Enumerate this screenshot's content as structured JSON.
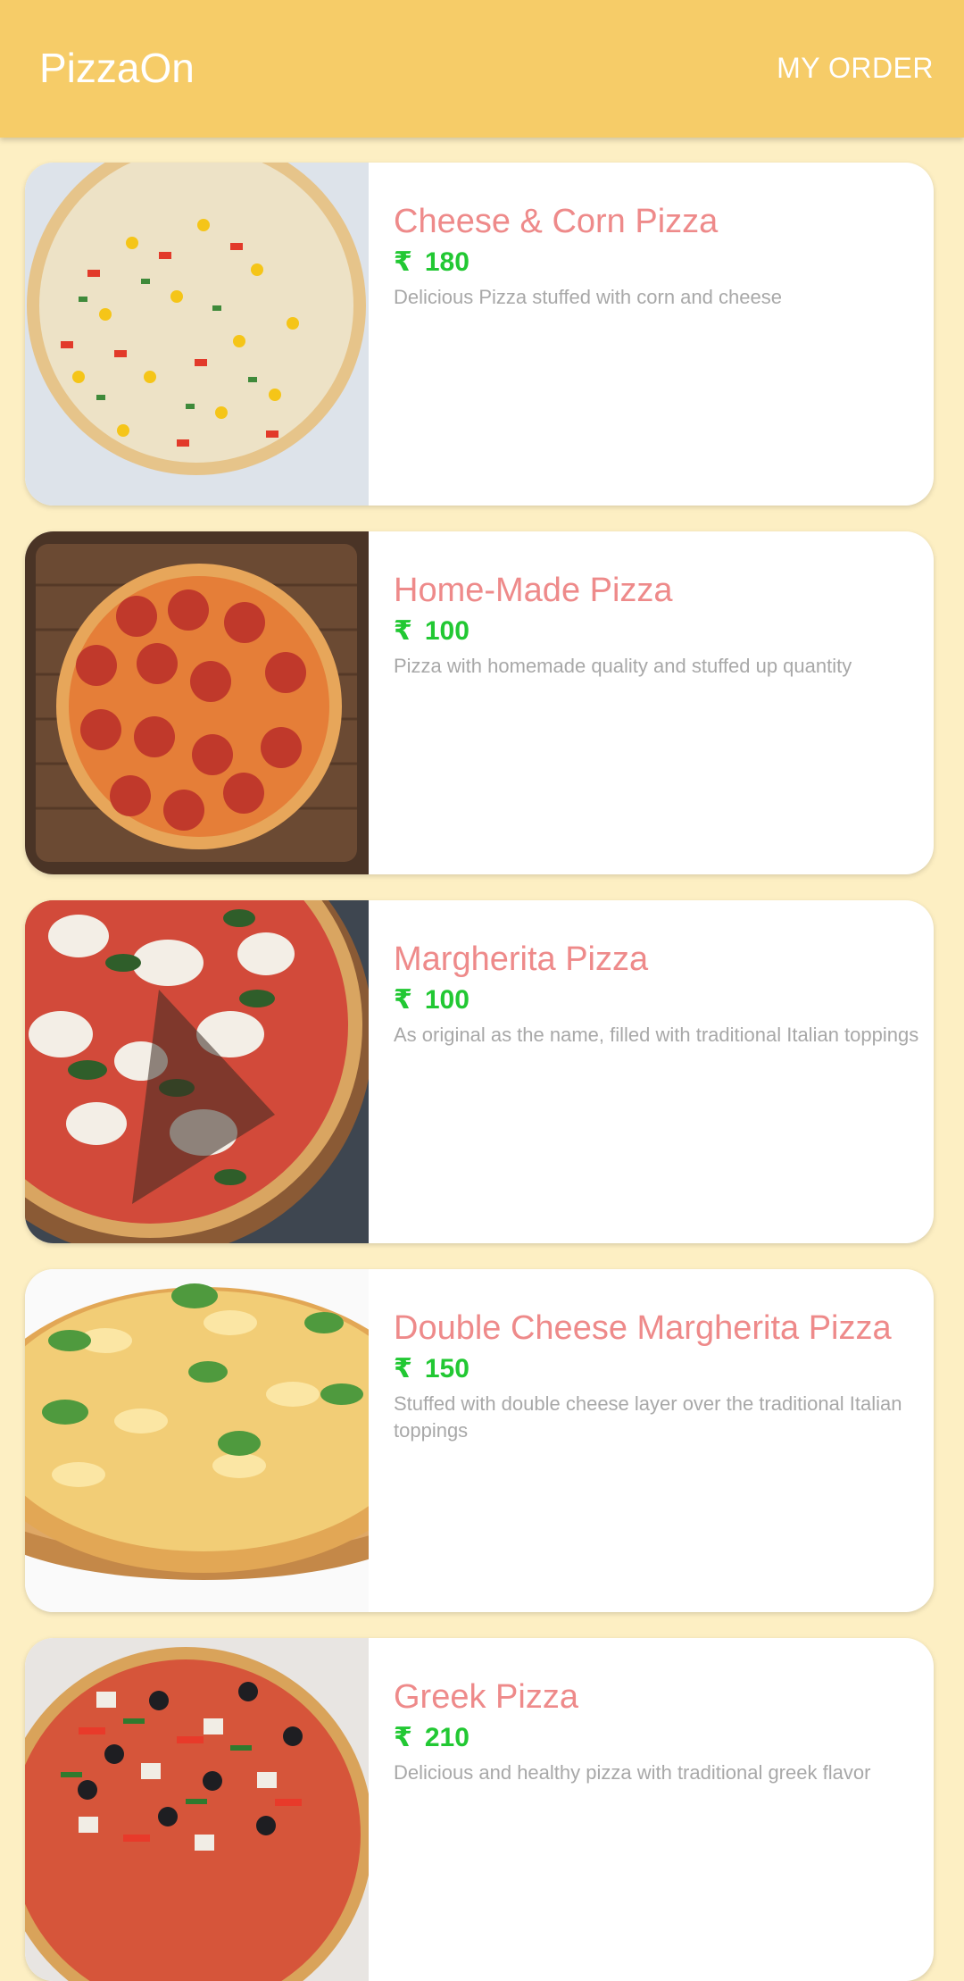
{
  "app_bar": {
    "title": "PizzaOn",
    "my_order_label": "MY ORDER",
    "background": "#F6CC68"
  },
  "currency_symbol": "₹",
  "colors": {
    "page_background": "#FDEFC3",
    "name": "#EE8A8A",
    "price": "#22C833",
    "description": "#A8A8A8"
  },
  "pizzas": [
    {
      "name": "Cheese & Corn Pizza",
      "price": "180",
      "description": "Delicious Pizza stuffed with corn and cheese",
      "image": "cheese-corn-pizza-image"
    },
    {
      "name": "Home-Made Pizza",
      "price": "100",
      "description": "Pizza with homemade quality and stuffed up quantity",
      "image": "pepperoni-pizza-image"
    },
    {
      "name": "Margherita Pizza",
      "price": "100",
      "description": "As original as the name, filled with traditional Italian toppings",
      "image": "margherita-pizza-image"
    },
    {
      "name": "Double Cheese Margherita Pizza",
      "price": "150",
      "description": "Stuffed with double cheese layer over the traditional Italian toppings",
      "image": "double-cheese-pizza-image"
    },
    {
      "name": "Greek Pizza",
      "price": "210",
      "description": "Delicious and healthy pizza with traditional greek flavor",
      "image": "greek-pizza-image"
    }
  ]
}
